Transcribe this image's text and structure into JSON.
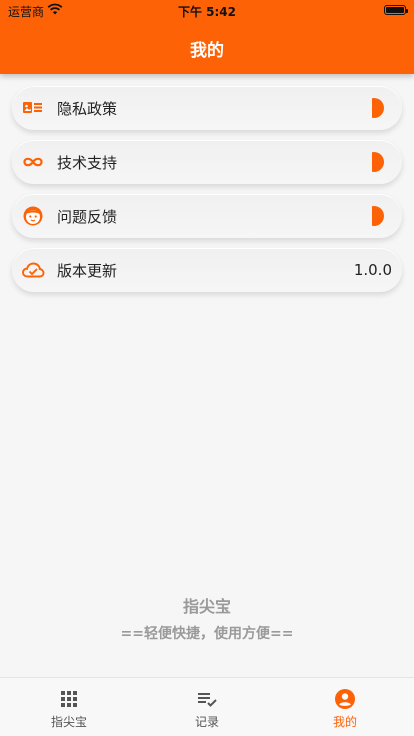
{
  "status_bar": {
    "carrier": "运营商",
    "time": "下午 5:42"
  },
  "header": {
    "title": "我的"
  },
  "menu": {
    "items": [
      {
        "icon": "id-card-icon",
        "label": "隐私政策"
      },
      {
        "icon": "infinity-icon",
        "label": "技术支持"
      },
      {
        "icon": "face-icon",
        "label": "问题反馈"
      },
      {
        "icon": "cloud-check-icon",
        "label": "版本更新",
        "value": "1.0.0"
      }
    ]
  },
  "footer": {
    "app_name": "指尖宝",
    "tagline": "==轻便快捷，使用方便=="
  },
  "tabbar": {
    "tabs": [
      {
        "label": "指尖宝",
        "icon": "grid-icon"
      },
      {
        "label": "记录",
        "icon": "list-check-icon"
      },
      {
        "label": "我的",
        "icon": "person-circle-icon",
        "active": true
      }
    ]
  },
  "colors": {
    "accent": "#fd6207",
    "background": "#f6f6f6",
    "muted_text": "#9a9a9a"
  }
}
